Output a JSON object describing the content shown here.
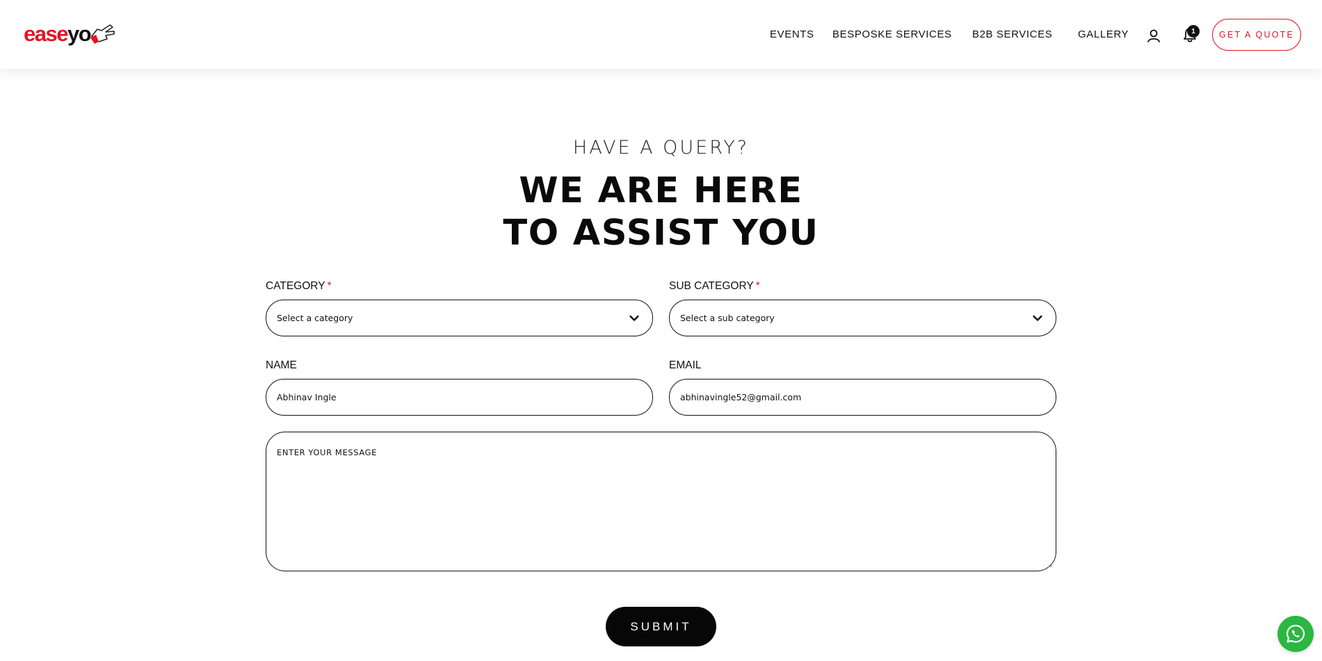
{
  "header": {
    "logo": {
      "part1": "ease",
      "part2": "yo"
    },
    "nav": [
      {
        "label": "EVENTS"
      },
      {
        "label": "BESPOSKE SERVICES"
      },
      {
        "label": "B2B SERVICES"
      },
      {
        "label": "GALLERY"
      }
    ],
    "user_icon": "user-icon",
    "notification_icon": "bell-icon",
    "notification_count": "1",
    "cta_label": "GET A QUOTE"
  },
  "hero": {
    "eyebrow": "HAVE A QUERY?",
    "title_line1": "WE ARE HERE",
    "title_line2": "TO ASSIST YOU"
  },
  "form": {
    "category": {
      "label": "CATEGORY",
      "required_mark": "*",
      "value": "Select a category"
    },
    "sub_category": {
      "label": "SUB CATEGORY",
      "required_mark": "*",
      "value": "Select a sub category"
    },
    "name": {
      "label": "NAME",
      "value": "Abhinav Ingle"
    },
    "email": {
      "label": "EMAIL",
      "value": "abhinavingle52@gmail.com"
    },
    "message": {
      "placeholder": "ENTER YOUR MESSAGE"
    },
    "submit_label": "SUBMIT"
  },
  "floating": {
    "whatsapp_icon": "whatsapp-icon"
  },
  "colors": {
    "brand_red": "#e4141f",
    "dark": "#070707",
    "whatsapp_green": "#2bb741"
  }
}
